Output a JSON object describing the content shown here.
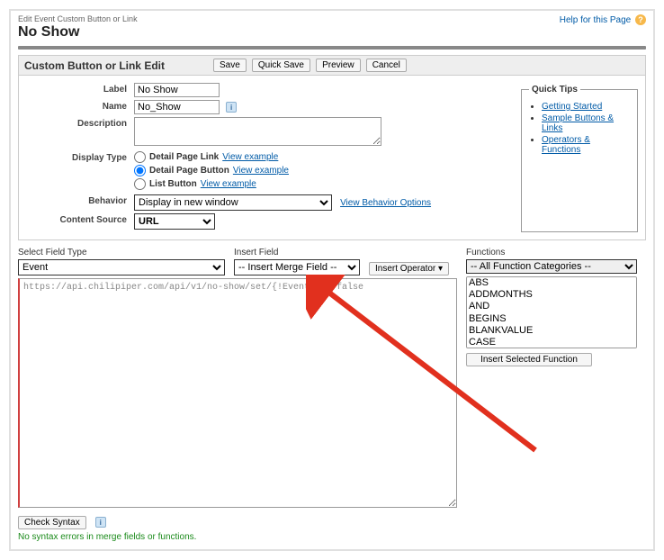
{
  "header": {
    "breadcrumb": "Edit Event Custom Button or Link",
    "title": "No Show",
    "help_text": "Help for this Page"
  },
  "section": {
    "title": "Custom Button or Link Edit",
    "buttons": {
      "save": "Save",
      "quick_save": "Quick Save",
      "preview": "Preview",
      "cancel": "Cancel"
    }
  },
  "labels": {
    "label": "Label",
    "name": "Name",
    "description": "Description",
    "display_type": "Display Type",
    "behavior": "Behavior",
    "content_source": "Content Source"
  },
  "fields": {
    "label_value": "No Show",
    "name_value": "No_Show",
    "description_value": "",
    "display_type": {
      "page_link": "Detail Page Link",
      "page_button": "Detail Page Button",
      "list_button": "List Button",
      "view_example": "View example"
    },
    "behavior_value": "Display in new window",
    "behavior_link": "View Behavior Options",
    "content_source_value": "URL"
  },
  "quick_tips": {
    "legend": "Quick Tips",
    "items": [
      "Getting Started",
      "Sample Buttons & Links",
      "Operators & Functions"
    ]
  },
  "editor": {
    "select_field_type_label": "Select Field Type",
    "select_field_type_value": "Event",
    "insert_field_label": "Insert Field",
    "insert_field_value": "-- Insert Merge Field --",
    "insert_operator": "Insert Operator",
    "functions_label": "Functions",
    "func_cat_value": "-- All Function Categories --",
    "func_list": [
      "ABS",
      "ADDMONTHS",
      "AND",
      "BEGINS",
      "BLANKVALUE",
      "CASE"
    ],
    "insert_selected": "Insert Selected Function",
    "code_value": "https://api.chilipiper.com/api/v1/no-show/set/{!Event.Id}/false"
  },
  "syntax": {
    "check": "Check Syntax",
    "ok_msg": "No syntax errors in merge fields or functions."
  }
}
